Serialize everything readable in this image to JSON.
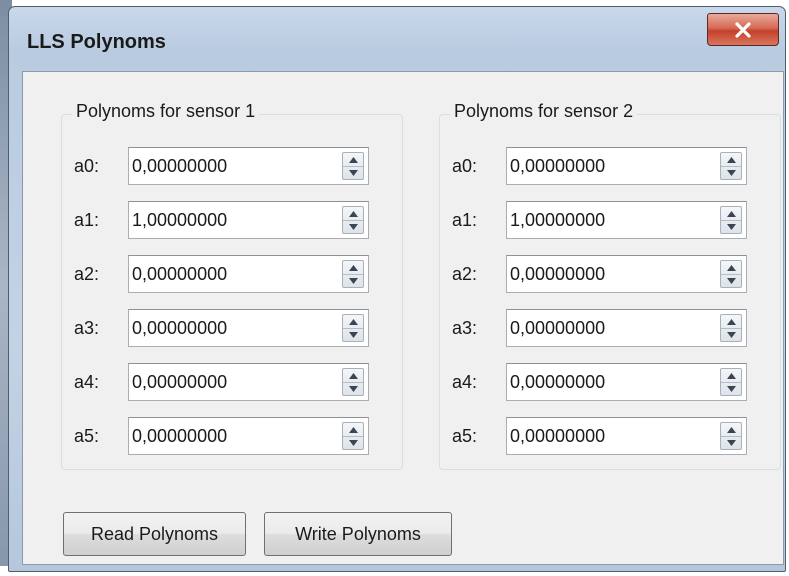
{
  "window": {
    "title": "LLS Polynoms",
    "close_icon": "close-x-icon",
    "accent_close": "#c4412b"
  },
  "sensor1": {
    "title": "Polynoms for sensor 1",
    "rows": [
      {
        "label": "a0:",
        "value": "0,00000000"
      },
      {
        "label": "a1:",
        "value": "1,00000000"
      },
      {
        "label": "a2:",
        "value": "0,00000000"
      },
      {
        "label": "a3:",
        "value": "0,00000000"
      },
      {
        "label": "a4:",
        "value": "0,00000000"
      },
      {
        "label": "a5:",
        "value": "0,00000000"
      }
    ]
  },
  "sensor2": {
    "title": "Polynoms for sensor 2",
    "rows": [
      {
        "label": "a0:",
        "value": "0,00000000"
      },
      {
        "label": "a1:",
        "value": "1,00000000"
      },
      {
        "label": "a2:",
        "value": "0,00000000"
      },
      {
        "label": "a3:",
        "value": "0,00000000"
      },
      {
        "label": "a4:",
        "value": "0,00000000"
      },
      {
        "label": "a5:",
        "value": "0,00000000"
      }
    ]
  },
  "buttons": {
    "read": "Read Polynoms",
    "write": "Write Polynoms"
  },
  "icons": {
    "spin_up": "chevron-up-icon",
    "spin_down": "chevron-down-icon"
  }
}
